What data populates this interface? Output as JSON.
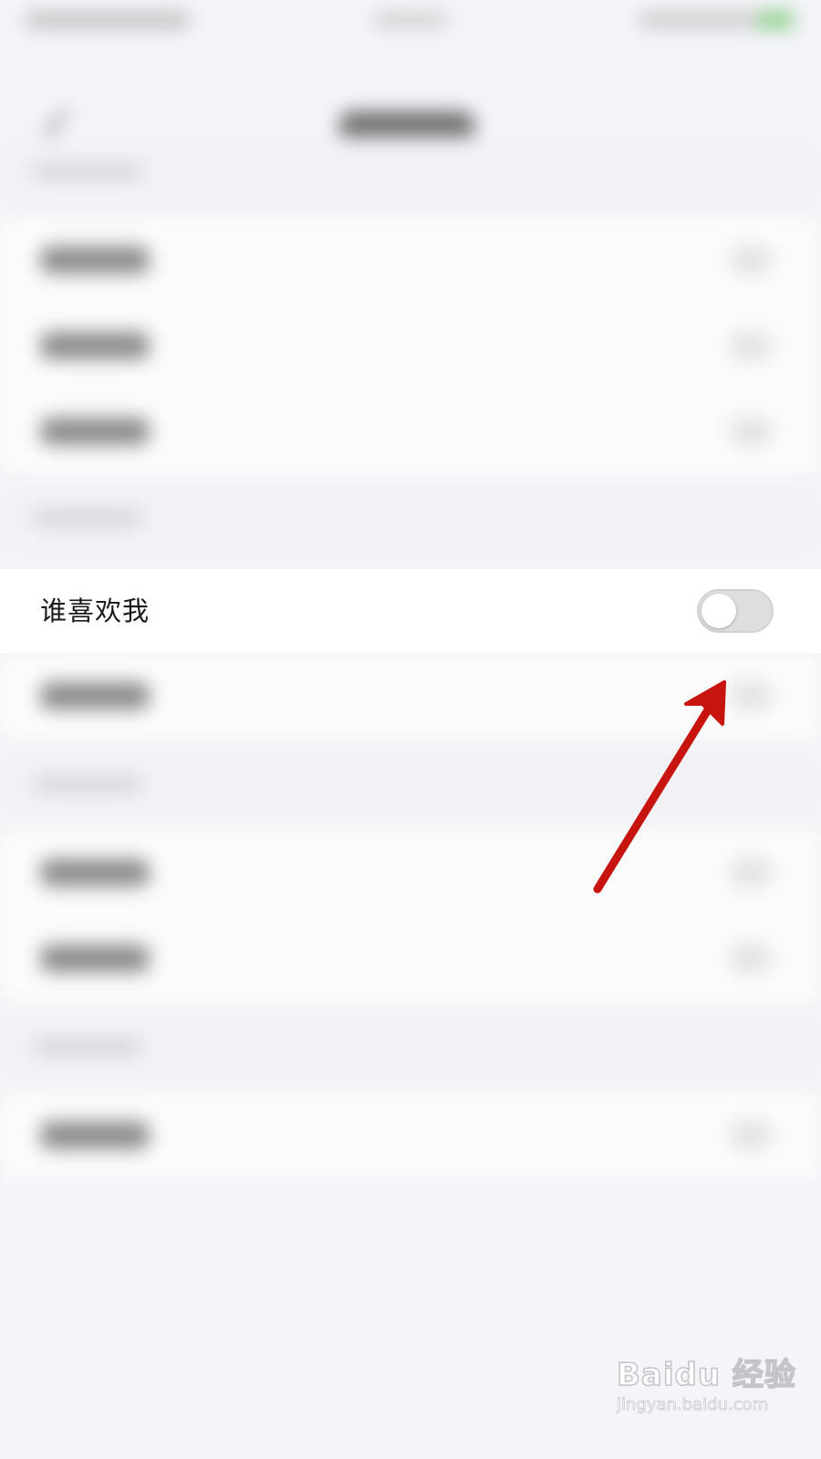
{
  "setting": {
    "label": "谁喜欢我",
    "toggle_on": false,
    "toggle_track_color": "#dedede"
  },
  "annotation": {
    "arrow_color": "#c8140f",
    "arrow_icon": "red-arrow-icon"
  },
  "watermark": {
    "logo_text": "Baidu 经验",
    "url": "jingyan.baidu.com"
  }
}
